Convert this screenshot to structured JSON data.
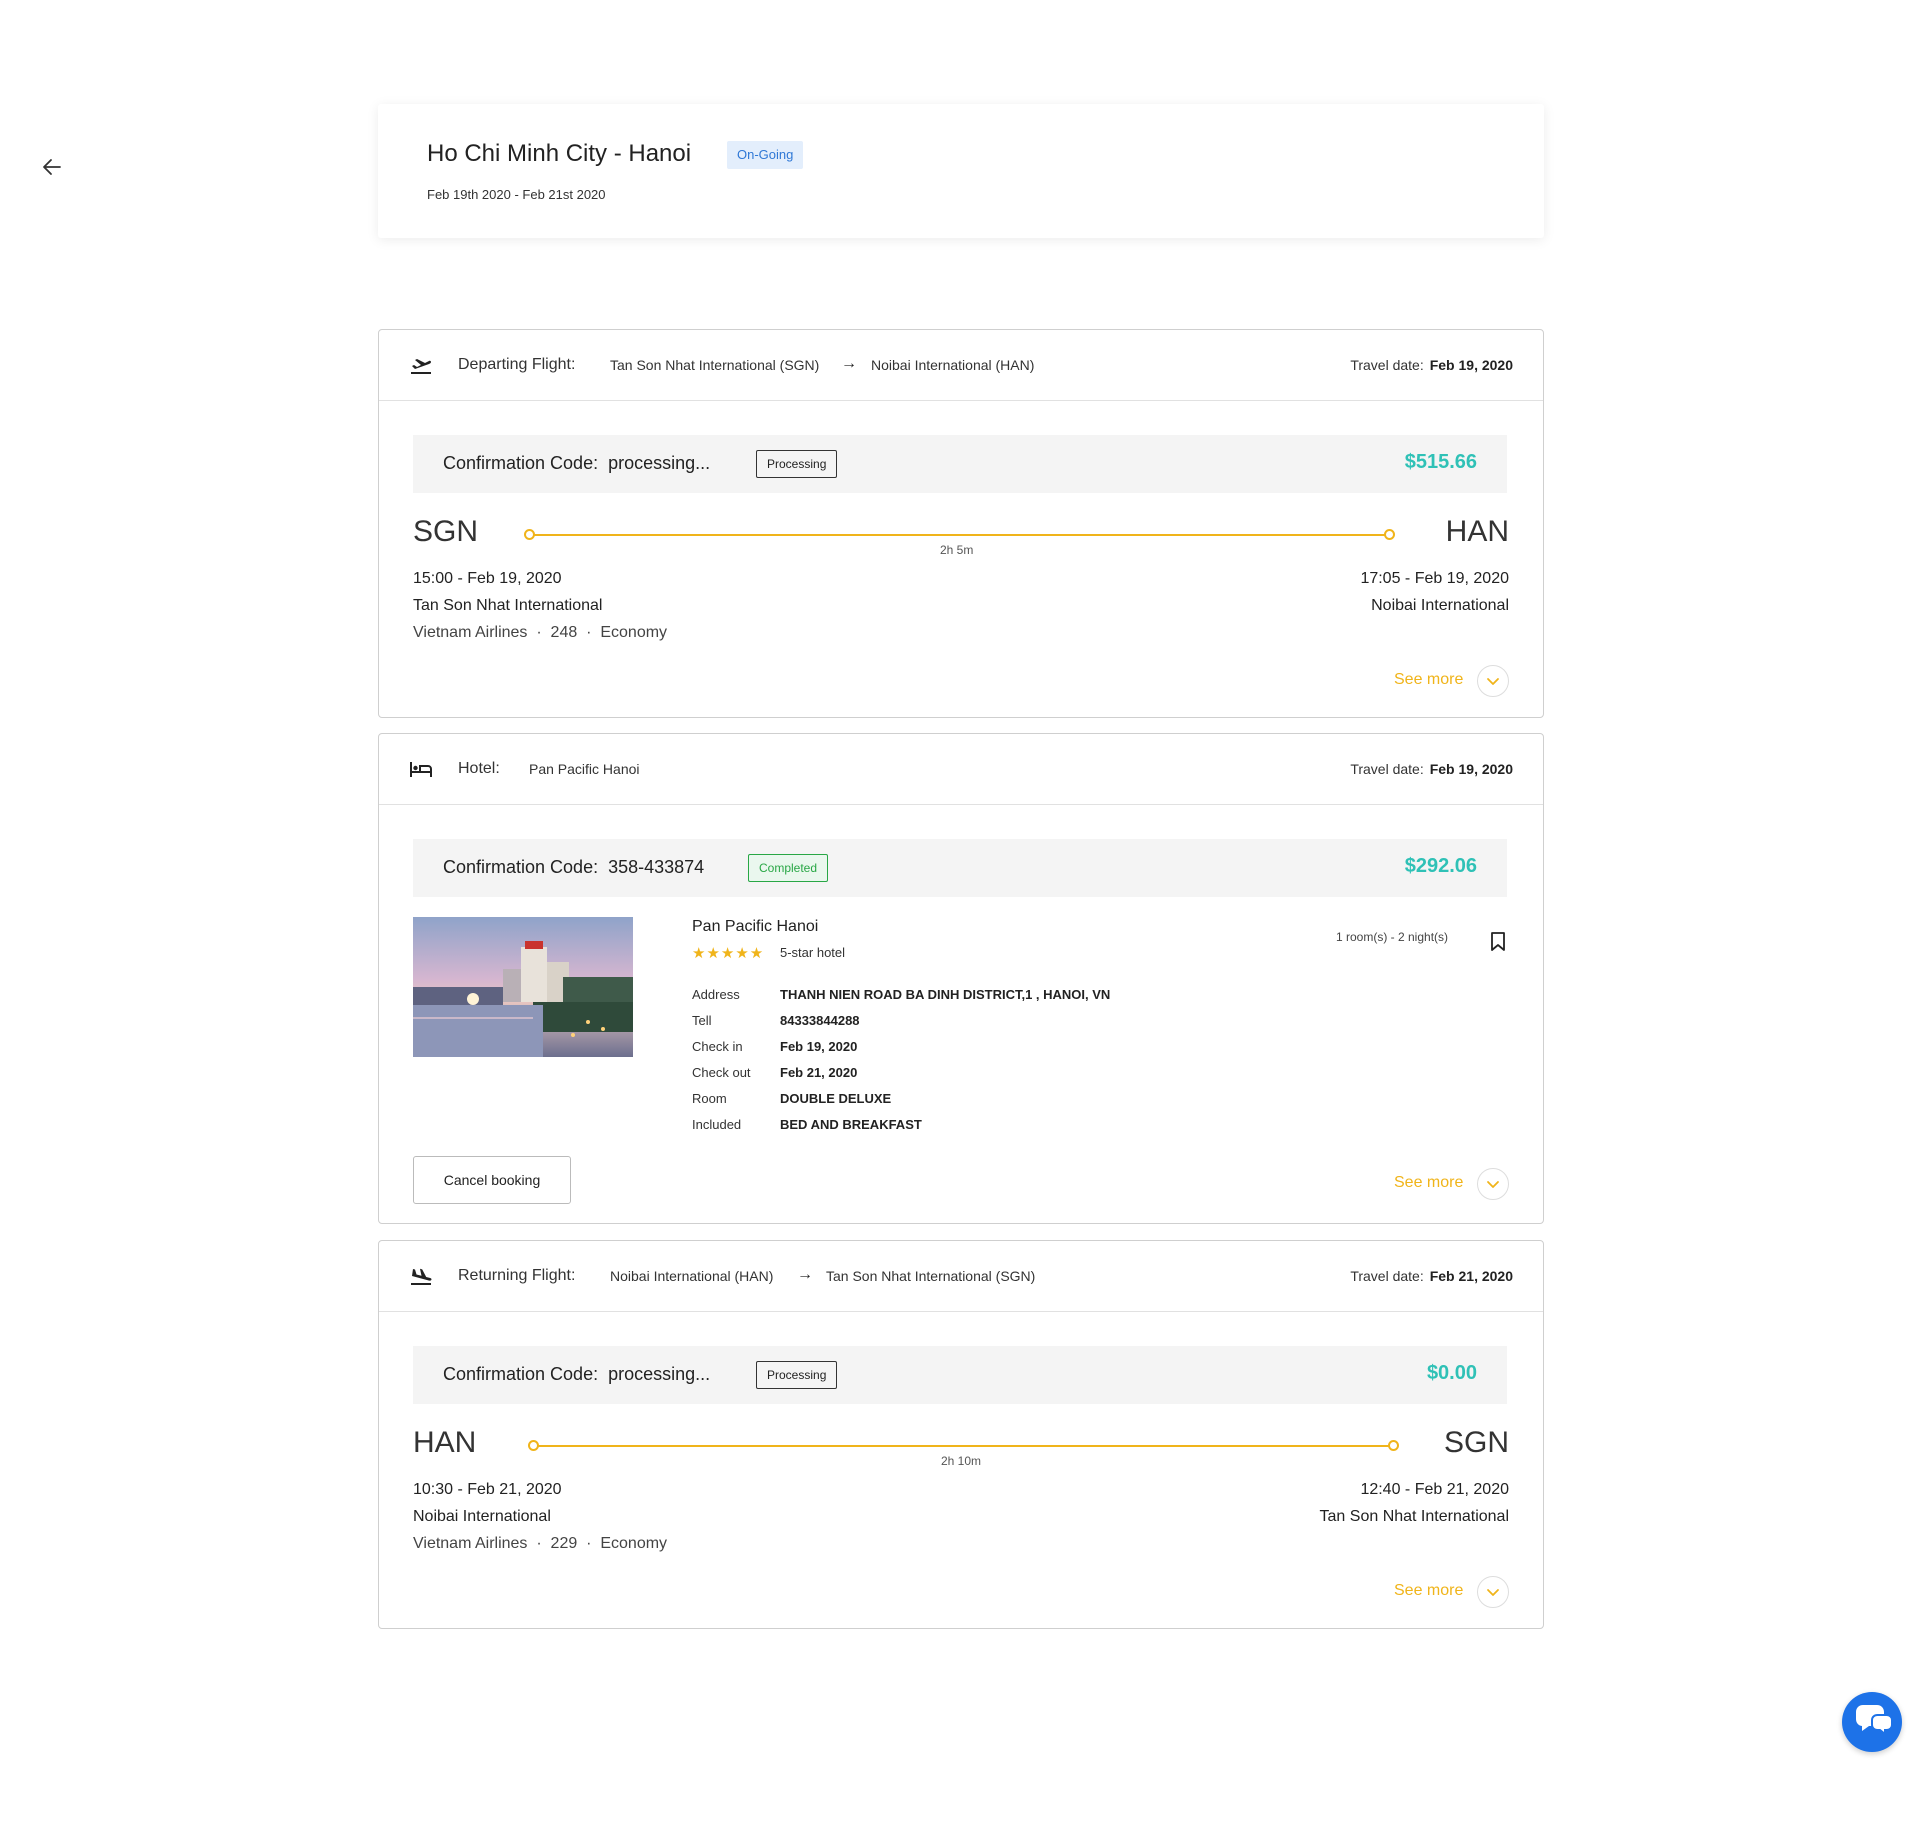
{
  "trip": {
    "title": "Ho Chi Minh City - Hanoi",
    "status": "On-Going",
    "dates": "Feb 19th 2020 - Feb 21st 2020"
  },
  "colors": {
    "accent": "#f0b41a",
    "price": "#2fc1b6",
    "status_bg": "#e3eefc",
    "status_text": "#2f78d6",
    "completed": "#28a745",
    "chat": "#1d72e8"
  },
  "departing": {
    "label": "Departing Flight:",
    "from": "Tan Son Nhat International (SGN)",
    "to": "Noibai International (HAN)",
    "travel_date_label": "Travel date:",
    "travel_date": "Feb 19, 2020",
    "conf_label": "Confirmation Code:",
    "conf_code": "processing...",
    "badge": "Processing",
    "price": "$515.66",
    "origin_code": "SGN",
    "dest_code": "HAN",
    "duration": "2h 5m",
    "dep_time": "15:00 - Feb 19, 2020",
    "dep_airport": "Tan Son Nhat International",
    "airline": "Vietnam Airlines",
    "flight_no": "248",
    "cabin": "Economy",
    "arr_time": "17:05 - Feb 19, 2020",
    "arr_airport": "Noibai International",
    "see_more": "See more"
  },
  "hotel": {
    "label": "Hotel:",
    "name_header": "Pan Pacific Hanoi",
    "travel_date_label": "Travel date:",
    "travel_date": "Feb 19, 2020",
    "conf_label": "Confirmation Code:",
    "conf_code": "358-433874",
    "badge": "Completed",
    "price": "$292.06",
    "name": "Pan Pacific Hanoi",
    "stars": "★★★★★",
    "star_label": "5-star hotel",
    "rooms": "1 room(s) - 2 night(s)",
    "details": [
      {
        "key": "Address",
        "value": "THANH NIEN ROAD BA DINH DISTRICT,1 , HANOI, VN"
      },
      {
        "key": "Tell",
        "value": "84333844288"
      },
      {
        "key": "Check in",
        "value": "Feb 19, 2020"
      },
      {
        "key": "Check out",
        "value": "Feb 21, 2020"
      },
      {
        "key": "Room",
        "value": "DOUBLE DELUXE"
      },
      {
        "key": "Included",
        "value": "BED AND BREAKFAST"
      }
    ],
    "cancel_label": "Cancel booking",
    "see_more": "See more"
  },
  "returning": {
    "label": "Returning Flight:",
    "from": "Noibai International (HAN)",
    "to": "Tan Son Nhat International (SGN)",
    "travel_date_label": "Travel date:",
    "travel_date": "Feb 21, 2020",
    "conf_label": "Confirmation Code:",
    "conf_code": "processing...",
    "badge": "Processing",
    "price": "$0.00",
    "origin_code": "HAN",
    "dest_code": "SGN",
    "duration": "2h 10m",
    "dep_time": "10:30 - Feb 21, 2020",
    "dep_airport": "Noibai International",
    "airline": "Vietnam Airlines",
    "flight_no": "229",
    "cabin": "Economy",
    "arr_time": "12:40 - Feb 21, 2020",
    "arr_airport": "Tan Son Nhat International",
    "see_more": "See more"
  }
}
